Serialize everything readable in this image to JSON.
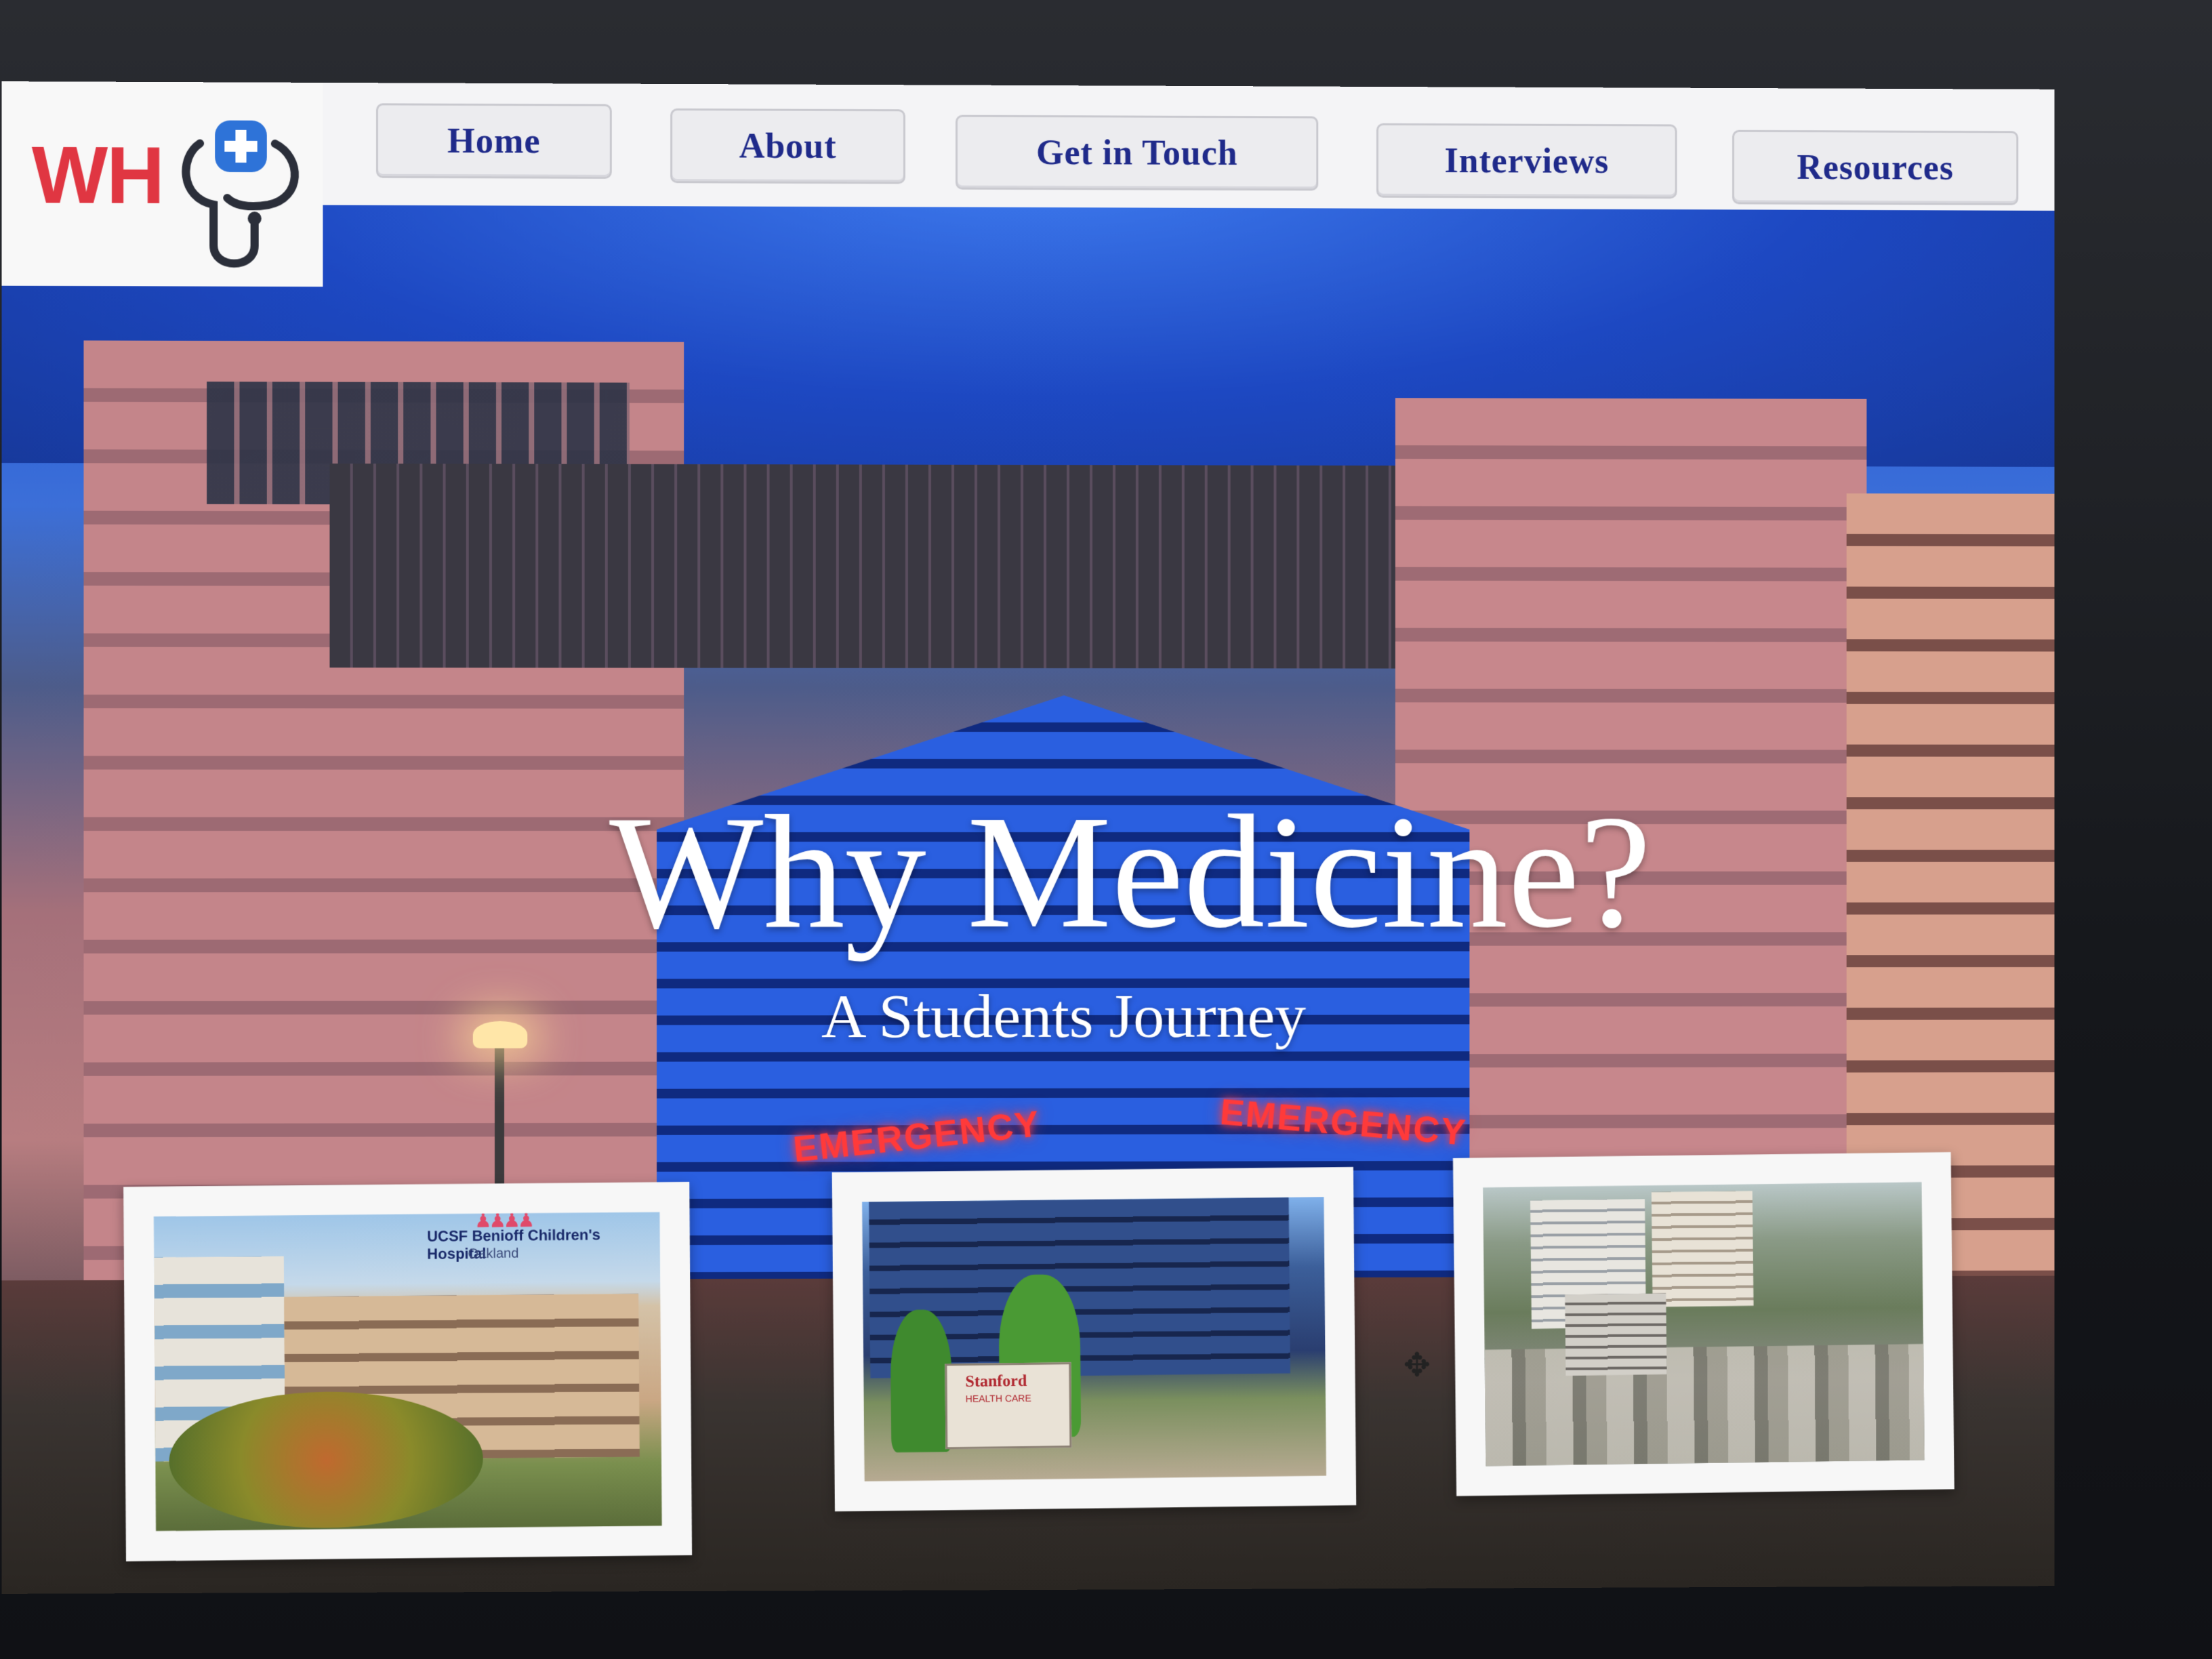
{
  "logo": {
    "text": "WH",
    "accent_color": "#e03642",
    "icon": "stethoscope-icon"
  },
  "nav": {
    "items": [
      {
        "label": "Home"
      },
      {
        "label": "About"
      },
      {
        "label": "Get in Touch"
      },
      {
        "label": "Interviews"
      },
      {
        "label": "Resources"
      }
    ],
    "text_color": "#1f2a8a"
  },
  "hero": {
    "title": "Why Medicine?",
    "subtitle": "A Students Journey",
    "signs": [
      "EMERGENCY",
      "EMERGENCY"
    ]
  },
  "photos": [
    {
      "caption": "UCSF Benioff Children's Hospital",
      "caption_sub": "Oakland"
    },
    {
      "caption": "Stanford",
      "caption_sub": "HEALTH CARE"
    },
    {
      "caption": ""
    }
  ]
}
